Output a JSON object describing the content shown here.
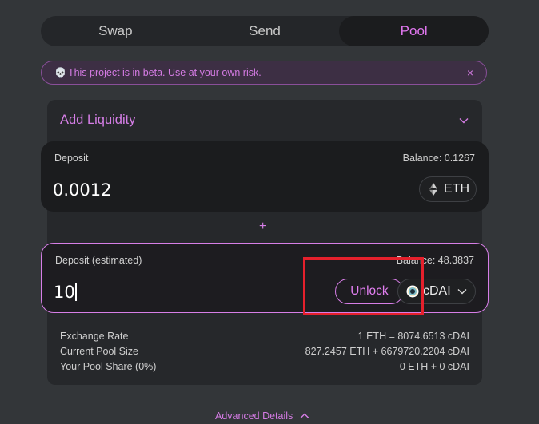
{
  "tabs": [
    {
      "label": "Swap",
      "active": false
    },
    {
      "label": "Send",
      "active": false
    },
    {
      "label": "Pool",
      "active": true
    }
  ],
  "beta_banner": {
    "text": "This project is in beta. Use at your own risk.",
    "close": "×"
  },
  "panel": {
    "title": "Add Liquidity"
  },
  "deposit": {
    "label": "Deposit",
    "balance": "Balance: 0.1267",
    "value": "0.0012",
    "token": "ETH"
  },
  "plus": "+",
  "deposit_estimated": {
    "label": "Deposit (estimated)",
    "balance": "Balance: 48.3837",
    "value": "10",
    "unlock": "Unlock",
    "token": "cDAI"
  },
  "info": {
    "exchange_rate_label": "Exchange Rate",
    "exchange_rate_value": "1 ETH = 8074.6513 cDAI",
    "pool_size_label": "Current Pool Size",
    "pool_size_value": "827.2457 ETH + 6679720.2204 cDAI",
    "pool_share_label": "Your Pool Share (0%)",
    "pool_share_value": "0 ETH + 0 cDAI"
  },
  "advanced": "Advanced Details",
  "colors": {
    "accent": "#d77ee7",
    "highlight": "#e5202c"
  }
}
